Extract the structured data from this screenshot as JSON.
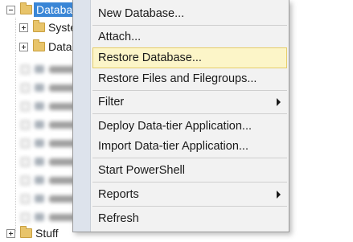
{
  "explorer": {
    "root_label": "Databases",
    "child_1_label": "System Databases",
    "child_2_label": "Database Snapshots",
    "bottom_label": "Stuff"
  },
  "context_menu": {
    "items": [
      {
        "label": "New Database..."
      },
      {
        "label": "Attach..."
      },
      {
        "label": "Restore Database..."
      },
      {
        "label": "Restore Files and Filegroups..."
      },
      {
        "label": "Filter"
      },
      {
        "label": "Deploy Data-tier Application..."
      },
      {
        "label": "Import Data-tier Application..."
      },
      {
        "label": "Start PowerShell"
      },
      {
        "label": "Reports"
      },
      {
        "label": "Refresh"
      }
    ]
  },
  "colors": {
    "selection": "#3a86d6",
    "hover_fill": "#fcf5c8",
    "hover_border": "#e5cd69",
    "menu_bg": "#f2f2f2",
    "gutter": "#dde3ec"
  }
}
